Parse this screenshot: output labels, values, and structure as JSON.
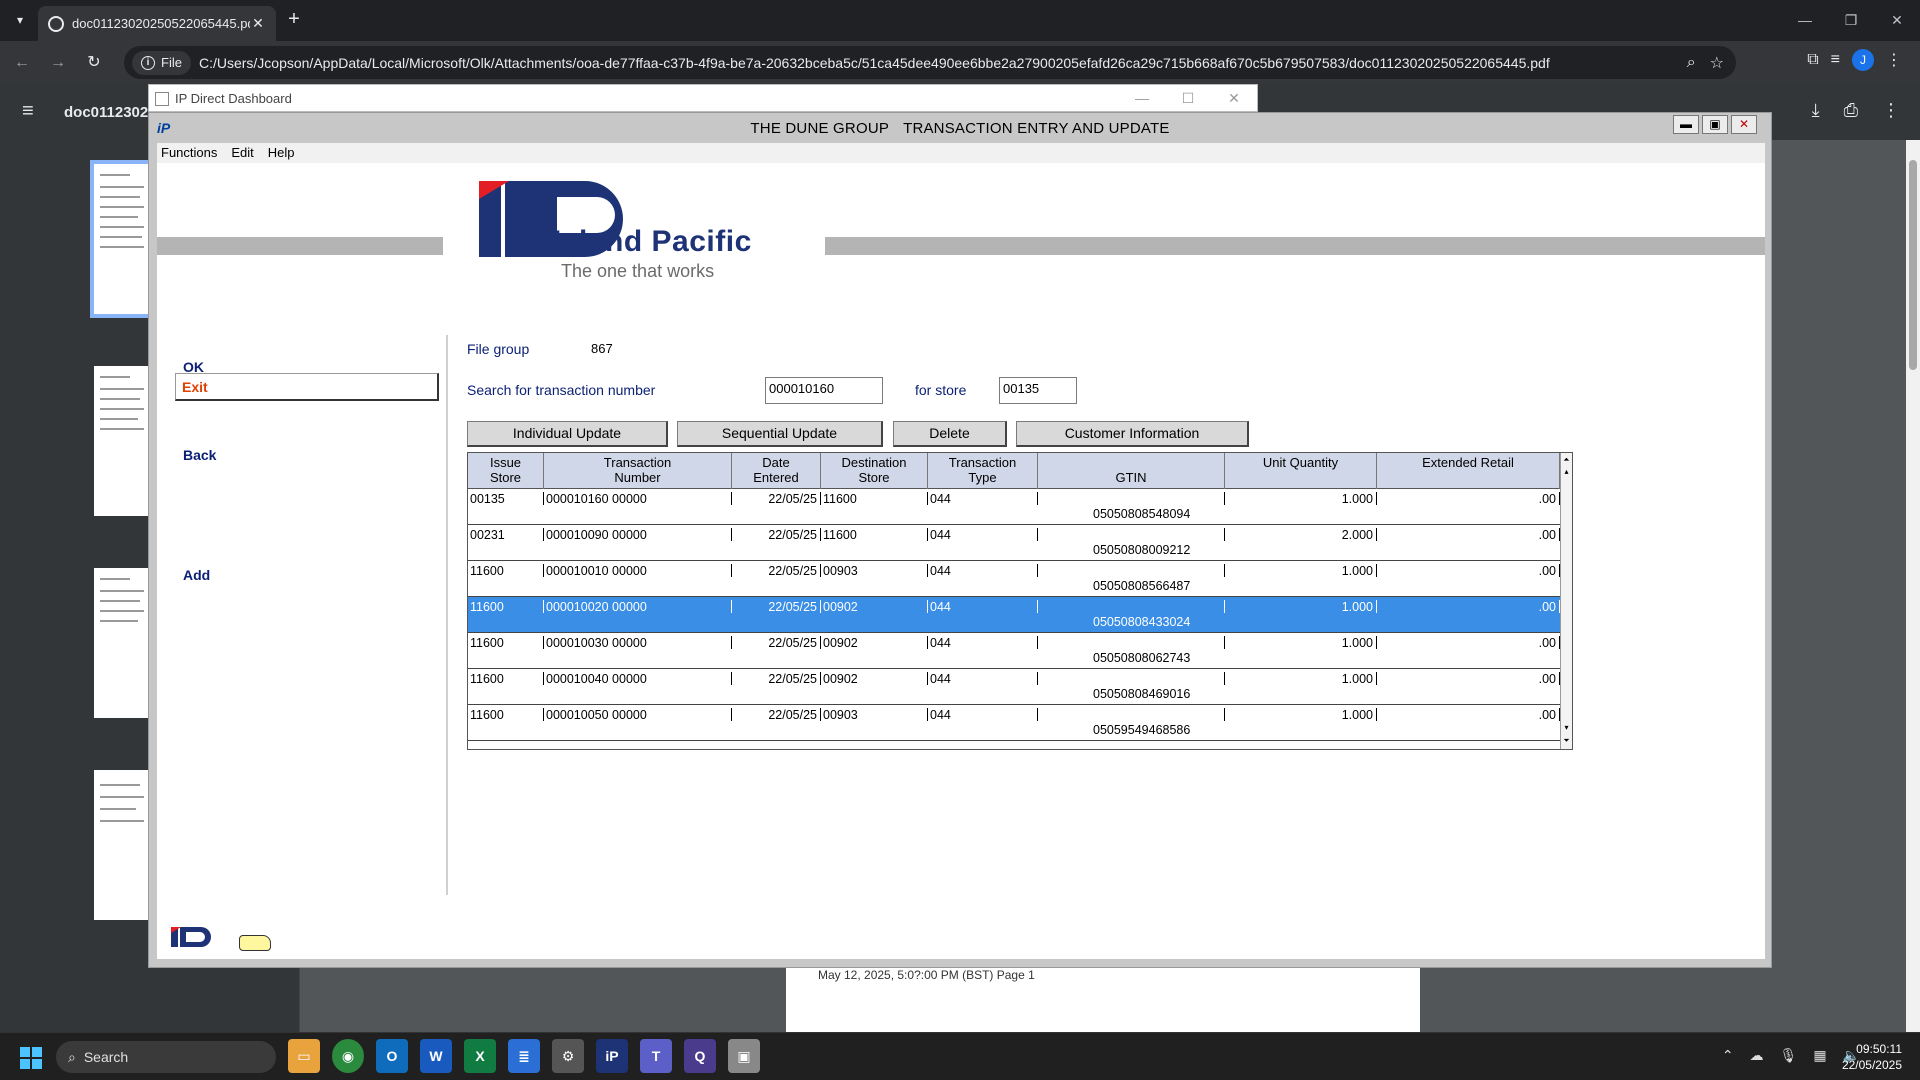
{
  "browser": {
    "tab_title": "doc01123020250522065445.pdf",
    "url_chip": "File",
    "url": "C:/Users/Jcopson/AppData/Local/Microsoft/Olk/Attachments/ooa-de77ffaa-c37b-4f9a-be7a-20632bceba5c/51ca45dee490ee6bbe2a27900205efafd26ca29c715b668af670c5b679507583/doc01123020250522065445.pdf",
    "profile_initial": "J"
  },
  "pdf_viewer": {
    "title": "doc01123020",
    "page_footer_text": "May 12, 2025, 5:0?:00 PM (BST) Page 1"
  },
  "dashboard": {
    "title": "IP Direct Dashboard"
  },
  "app": {
    "logo_small": "iP",
    "title_left": "THE DUNE GROUP",
    "title_right": "TRANSACTION ENTRY AND UPDATE",
    "menu": [
      "Functions",
      "Edit",
      "Help"
    ],
    "logo": {
      "name": "Island Pacific",
      "tagline": "The one that works"
    },
    "nav": {
      "ok": "OK",
      "exit": "Exit",
      "back": "Back",
      "add": "Add"
    },
    "form": {
      "file_group_label": "File group",
      "file_group_value": "867",
      "search_label": "Search for transaction number",
      "search_value": "000010160",
      "store_label": "for store",
      "store_value": "00135"
    },
    "buttons": {
      "individual_update": "Individual Update",
      "sequential_update": "Sequential Update",
      "delete": "Delete",
      "customer_information": "Customer Information"
    },
    "grid": {
      "headers": {
        "issue_store_1": "Issue",
        "issue_store_2": "Store",
        "trans_num_1": "Transaction",
        "trans_num_2": "Number",
        "date_1": "Date",
        "date_2": "Entered",
        "dest_1": "Destination",
        "dest_2": "Store",
        "type_1": "Transaction",
        "type_2": "Type",
        "gtin": "GTIN",
        "unit_qty": "Unit Quantity",
        "ext_retail": "Extended Retail"
      },
      "rows": [
        {
          "issue": "00135",
          "trans": "000010160 00000",
          "date": "22/05/25",
          "dest": "11600",
          "type": "044",
          "gtin": "05050808548094",
          "qty": "1.000",
          "retail": ".00"
        },
        {
          "issue": "00231",
          "trans": "000010090 00000",
          "date": "22/05/25",
          "dest": "11600",
          "type": "044",
          "gtin": "05050808009212",
          "qty": "2.000",
          "retail": ".00"
        },
        {
          "issue": "11600",
          "trans": "000010010 00000",
          "date": "22/05/25",
          "dest": "00903",
          "type": "044",
          "gtin": "05050808566487",
          "qty": "1.000",
          "retail": ".00"
        },
        {
          "issue": "11600",
          "trans": "000010020 00000",
          "date": "22/05/25",
          "dest": "00902",
          "type": "044",
          "gtin": "05050808433024",
          "qty": "1.000",
          "retail": ".00"
        },
        {
          "issue": "11600",
          "trans": "000010030 00000",
          "date": "22/05/25",
          "dest": "00902",
          "type": "044",
          "gtin": "05050808062743",
          "qty": "1.000",
          "retail": ".00"
        },
        {
          "issue": "11600",
          "trans": "000010040 00000",
          "date": "22/05/25",
          "dest": "00902",
          "type": "044",
          "gtin": "05050808469016",
          "qty": "1.000",
          "retail": ".00"
        },
        {
          "issue": "11600",
          "trans": "000010050 00000",
          "date": "22/05/25",
          "dest": "00903",
          "type": "044",
          "gtin": "05059549468586",
          "qty": "1.000",
          "retail": ".00"
        }
      ],
      "selected_row_index": 3
    }
  },
  "taskbar": {
    "search_placeholder": "Search",
    "time": "09:50:11",
    "date": "22/05/2025"
  },
  "colors": {
    "selection": "#3a8ee6",
    "nav_text": "#0a1f75",
    "exit_text": "#e04000",
    "logo_blue": "#1e3276",
    "logo_red": "#e31e24"
  }
}
